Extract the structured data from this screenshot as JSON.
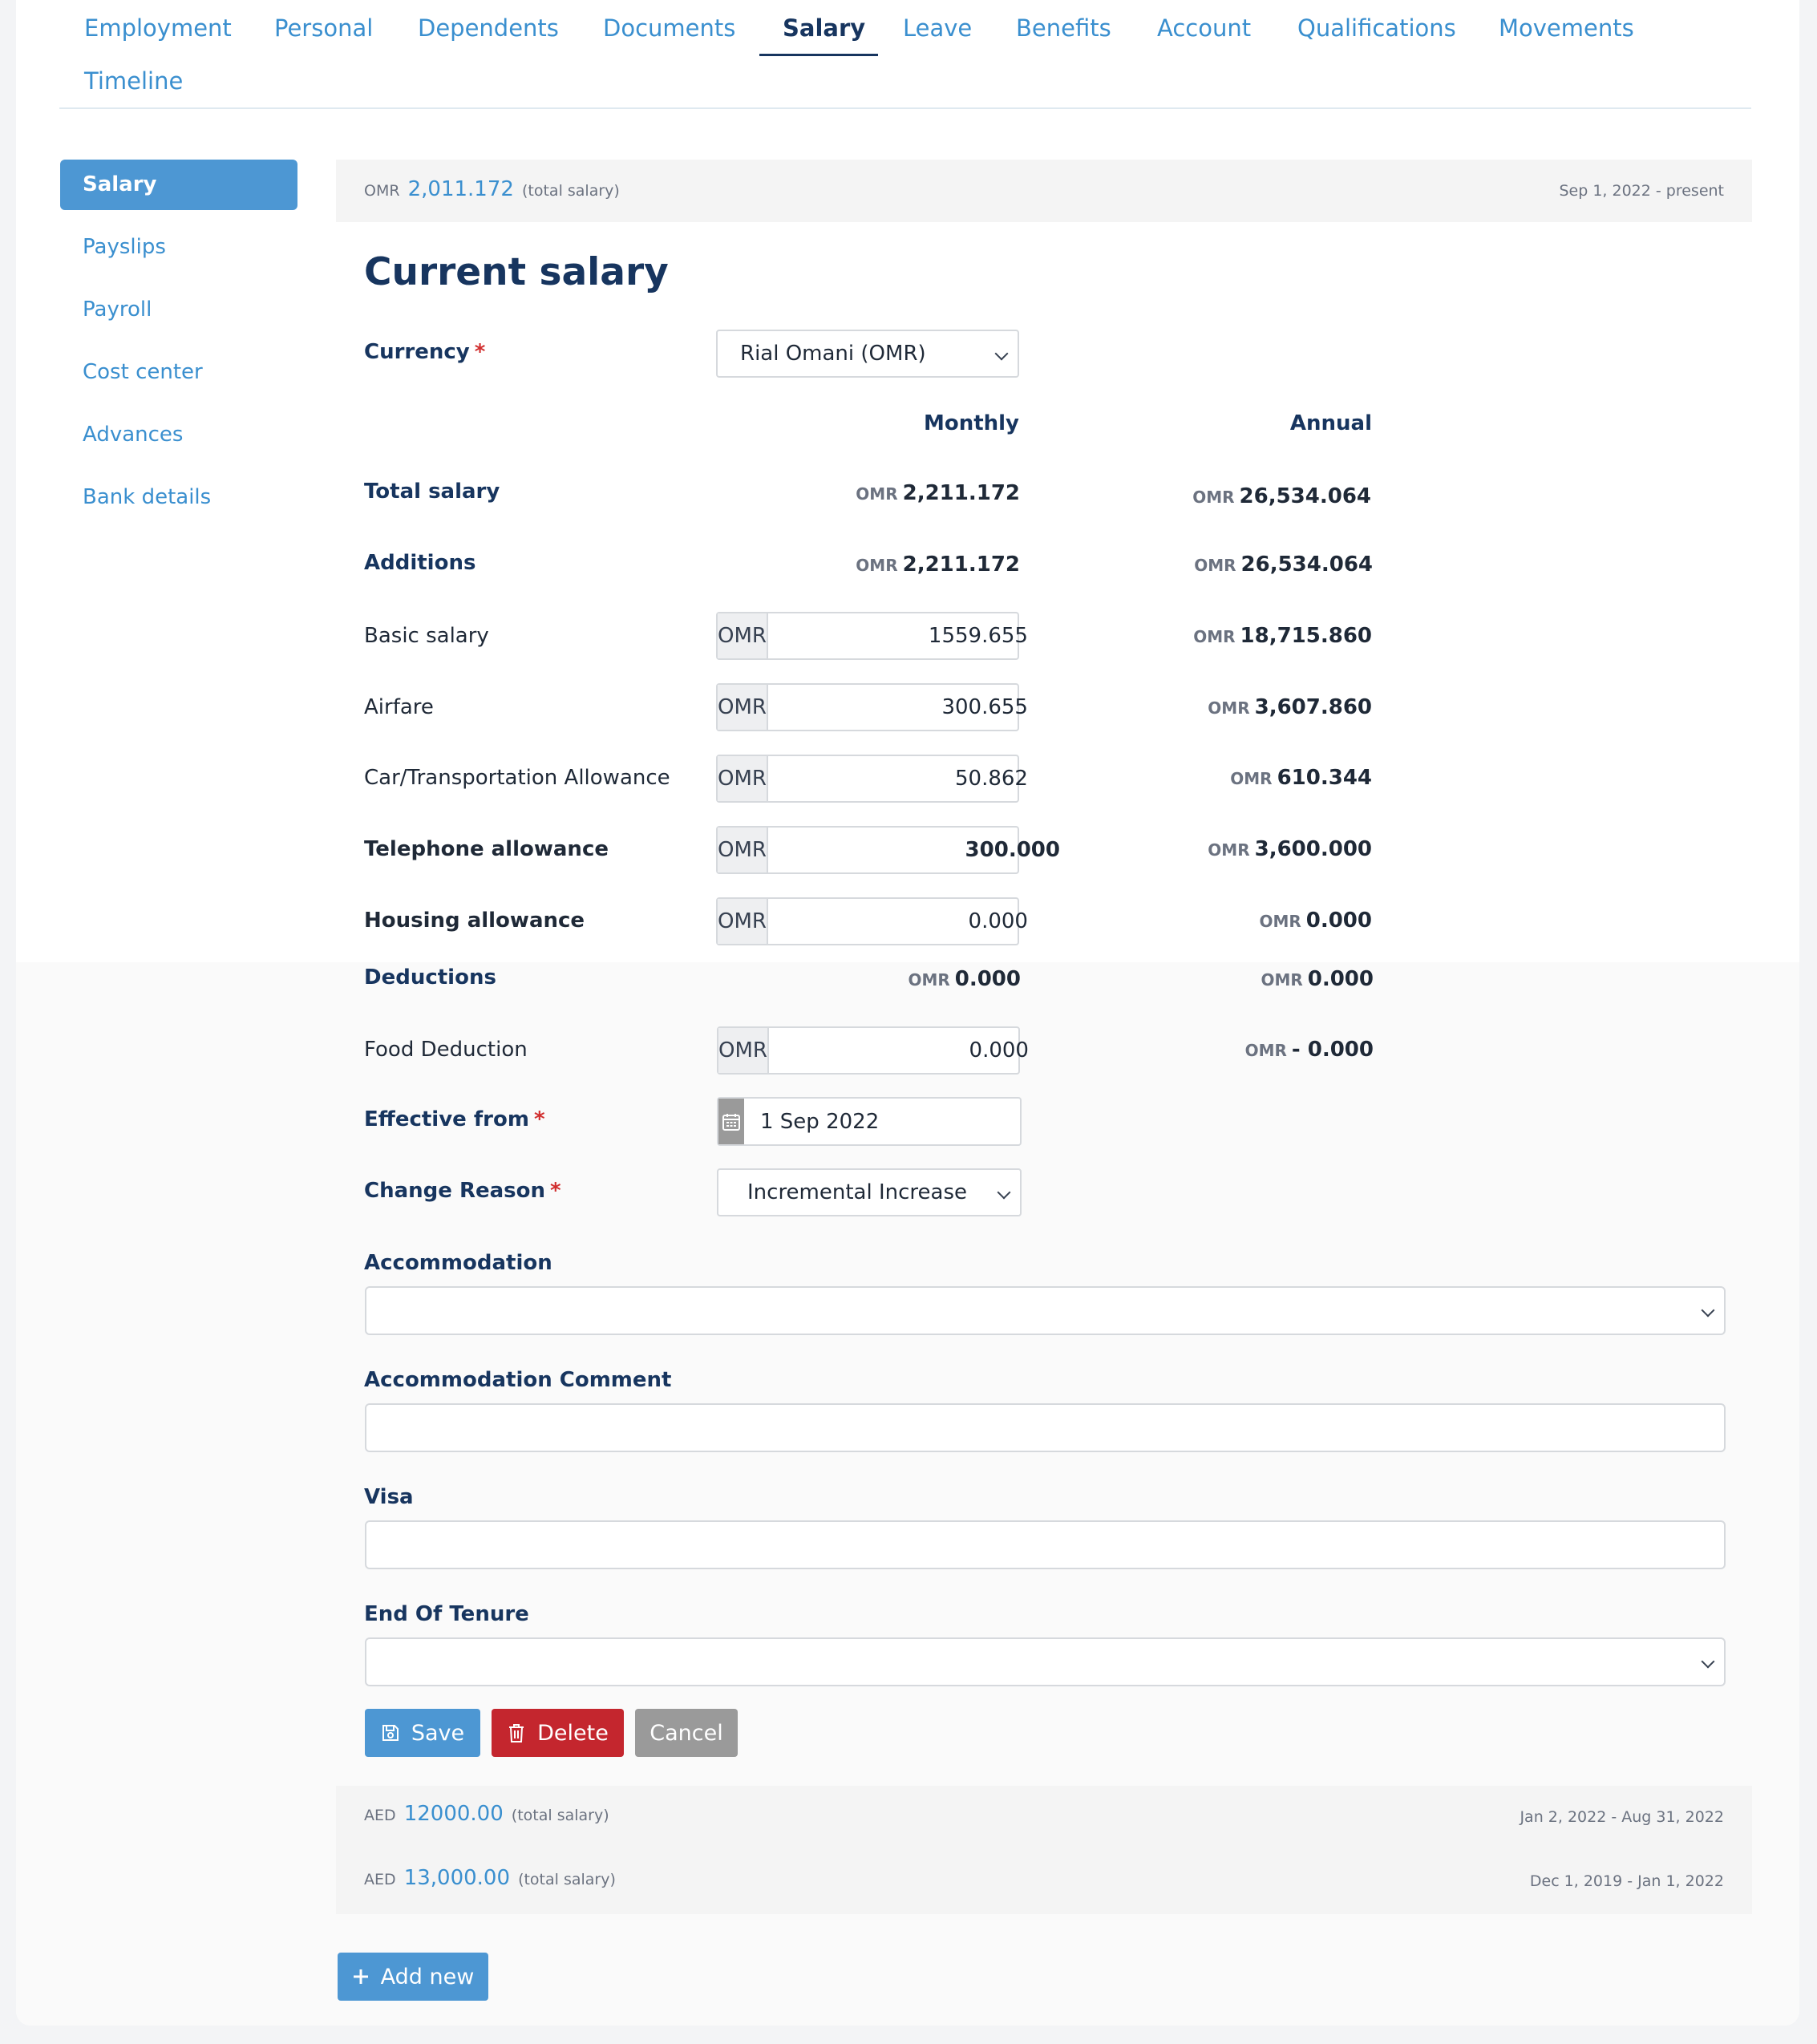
{
  "tabs": [
    {
      "label": "Employment"
    },
    {
      "label": "Personal"
    },
    {
      "label": "Dependents"
    },
    {
      "label": "Documents"
    },
    {
      "label": "Salary"
    },
    {
      "label": "Leave"
    },
    {
      "label": "Benefits"
    },
    {
      "label": "Account"
    },
    {
      "label": "Qualifications"
    },
    {
      "label": "Movements"
    },
    {
      "label": "Timeline"
    }
  ],
  "sidebar": {
    "items": [
      {
        "label": "Salary"
      },
      {
        "label": "Payslips"
      },
      {
        "label": "Payroll"
      },
      {
        "label": "Cost center"
      },
      {
        "label": "Advances"
      },
      {
        "label": "Bank details"
      }
    ]
  },
  "summary_current": {
    "currency": "OMR",
    "amount": "2,011.172",
    "note": "(total salary)",
    "period": "Sep 1, 2022 - present"
  },
  "form": {
    "title": "Current salary",
    "currency_label": "Currency",
    "currency_value": "Rial Omani (OMR)",
    "col_monthly": "Monthly",
    "col_annual": "Annual",
    "total_label": "Total salary",
    "total_monthly_cur": "OMR",
    "total_monthly": "2,211.172",
    "total_annual_cur": "OMR",
    "total_annual": "26,534.064",
    "additions_label": "Additions",
    "additions_monthly_cur": "OMR",
    "additions_monthly": "2,211.172",
    "additions_annual_cur": "OMR",
    "additions_annual": "26,534.064",
    "rows": [
      {
        "label": "Basic salary",
        "addon": "OMR",
        "value": "1559.655",
        "annual_cur": "OMR",
        "annual": "18,715.860"
      },
      {
        "label": "Airfare",
        "addon": "OMR",
        "value": "300.655",
        "annual_cur": "OMR",
        "annual": "3,607.860"
      },
      {
        "label": "Car/Transportation Allowance",
        "addon": "OMR",
        "value": "50.862",
        "annual_cur": "OMR",
        "annual": "610.344"
      },
      {
        "label": "Telephone allowance",
        "addon": "OMR",
        "value": "300.000",
        "annual_cur": "OMR",
        "annual": "3,600.000"
      },
      {
        "label": "Housing allowance",
        "addon": "OMR",
        "value": "0.000",
        "annual_cur": "OMR",
        "annual": "0.000"
      }
    ],
    "deductions_label": "Deductions",
    "deductions_monthly_cur": "OMR",
    "deductions_monthly": "0.000",
    "deductions_annual_cur": "OMR",
    "deductions_annual": "0.000",
    "food_label": "Food Deduction",
    "food_addon": "OMR",
    "food_value": "0.000",
    "food_annual_cur": "OMR",
    "food_annual": "- 0.000",
    "effective_label": "Effective from",
    "effective_value": "1 Sep 2022",
    "reason_label": "Change Reason",
    "reason_value": "Incremental Increase",
    "accommodation_label": "Accommodation",
    "accommodation_comment_label": "Accommodation Comment",
    "visa_label": "Visa",
    "tenure_label": "End Of Tenure",
    "required_mark": "*"
  },
  "buttons": {
    "save": "Save",
    "delete": "Delete",
    "cancel": "Cancel",
    "add_new": "Add new"
  },
  "history": [
    {
      "currency": "AED",
      "amount": "12000.00",
      "note": "(total salary)",
      "period": "Jan 2, 2022 - Aug 31, 2022"
    },
    {
      "currency": "AED",
      "amount": "13,000.00",
      "note": "(total salary)",
      "period": "Dec 1, 2019 - Jan 1, 2022"
    }
  ],
  "colors": {
    "accent": "#4d97d3",
    "link": "#3a8fcf",
    "heading": "#17355f",
    "danger": "#c4262e",
    "neutral": "#9a9a9a"
  },
  "icons": {
    "save": "floppy-disk-icon",
    "delete": "trash-icon",
    "add": "plus-icon",
    "date": "calendar-icon",
    "dropdown": "chevron-down-icon"
  }
}
